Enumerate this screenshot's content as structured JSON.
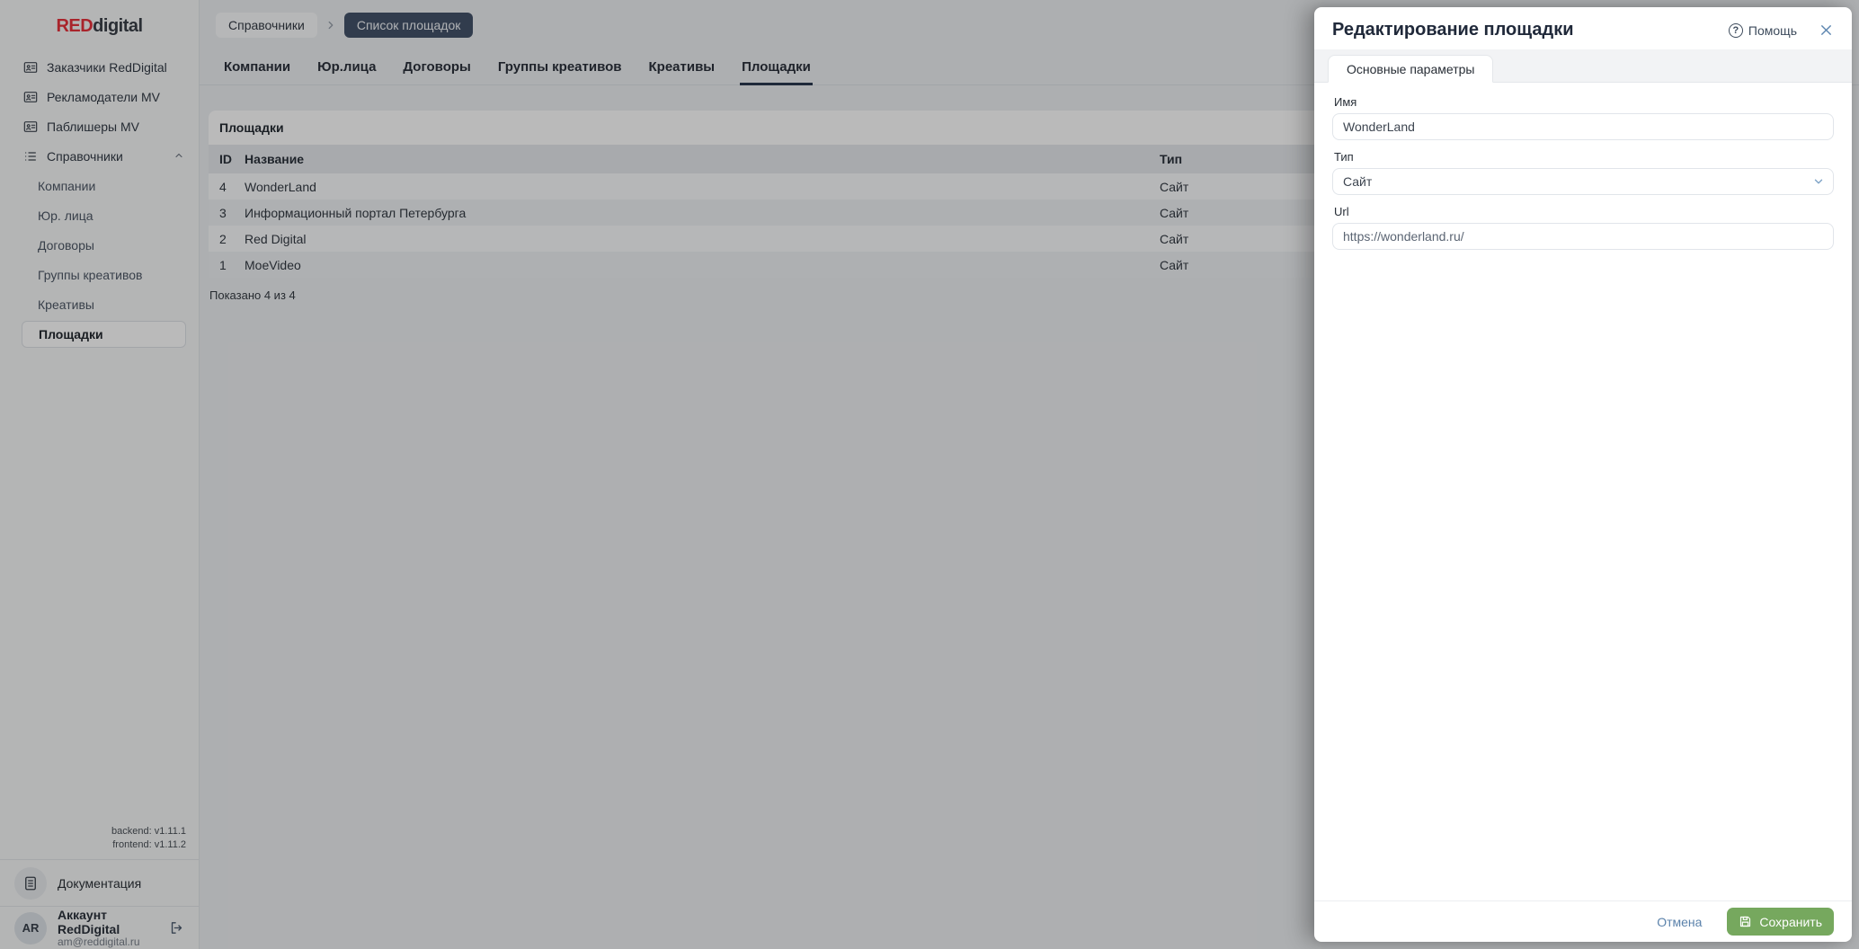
{
  "logo": {
    "red": "RED",
    "rest": "digital"
  },
  "sidebar": {
    "items": [
      {
        "label": "Заказчики RedDigital",
        "icon": "id-card"
      },
      {
        "label": "Рекламодатели MV",
        "icon": "id-card"
      },
      {
        "label": "Паблишеры MV",
        "icon": "id-card"
      },
      {
        "label": "Справочники",
        "icon": "list",
        "expanded": true
      }
    ],
    "sub_items": [
      {
        "label": "Компании"
      },
      {
        "label": "Юр. лица"
      },
      {
        "label": "Договоры"
      },
      {
        "label": "Группы креативов"
      },
      {
        "label": "Креативы"
      },
      {
        "label": "Площадки",
        "active": true
      }
    ],
    "versions": {
      "backend": "backend: v1.11.1",
      "frontend": "frontend: v1.11.2"
    },
    "docs_label": "Документация",
    "account": {
      "initials": "AR",
      "name": "Аккаунт RedDigital",
      "email": "am@reddigital.ru"
    }
  },
  "breadcrumb": {
    "first": "Справочники",
    "second": "Список площадок"
  },
  "tabs": {
    "items": [
      {
        "label": "Компании"
      },
      {
        "label": "Юр.лица"
      },
      {
        "label": "Договоры"
      },
      {
        "label": "Группы креативов"
      },
      {
        "label": "Креативы"
      },
      {
        "label": "Площадки",
        "active": true
      }
    ]
  },
  "table": {
    "title": "Площадки",
    "columns": {
      "id": "ID",
      "name": "Название",
      "type": "Тип"
    },
    "rows": [
      {
        "id": "4",
        "name": "WonderLand",
        "type": "Сайт"
      },
      {
        "id": "3",
        "name": "Информационный портал Петербурга",
        "type": "Сайт"
      },
      {
        "id": "2",
        "name": "Red Digital",
        "type": "Сайт"
      },
      {
        "id": "1",
        "name": "MoeVideo",
        "type": "Сайт"
      }
    ],
    "summary": "Показано 4 из 4"
  },
  "drawer": {
    "title": "Редактирование площадки",
    "help_label": "Помощь",
    "help_icon": "?",
    "tab_label": "Основные параметры",
    "fields": {
      "name": {
        "label": "Имя",
        "value": "WonderLand"
      },
      "type": {
        "label": "Тип",
        "value": "Сайт"
      },
      "url": {
        "label": "Url",
        "value": "https://wonderland.ru/"
      }
    },
    "cancel_label": "Отмена",
    "save_label": "Сохранить"
  },
  "colors": {
    "brand_red": "#e8323c",
    "save_green": "#76a85e",
    "link_blue": "#5b82ab",
    "breadcrumb_dark_pill": "#44536a",
    "tab_underline": "#2a3950"
  }
}
